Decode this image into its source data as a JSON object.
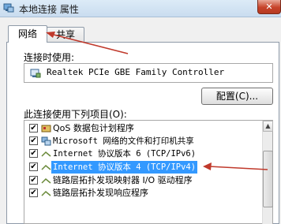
{
  "window": {
    "title": "本地连接 属性",
    "close_label": "✕"
  },
  "tabs": [
    {
      "label": "网络",
      "active": true
    },
    {
      "label": "共享",
      "active": false
    }
  ],
  "connect_using": {
    "label": "连接时使用:",
    "adapter": "Realtek PCIe GBE Family Controller",
    "configure_label": "配置(C)..."
  },
  "items_section": {
    "label": "此连接使用下列项目(O):",
    "items": [
      {
        "label": "QoS 数据包计划程序",
        "checked": true,
        "icon": "qos-icon"
      },
      {
        "label": "Microsoft 网络的文件和打印机共享",
        "checked": true,
        "icon": "network-share-icon"
      },
      {
        "label": "Internet 协议版本 6 (TCP/IPv6)",
        "checked": true,
        "icon": "protocol-icon"
      },
      {
        "label": "Internet 协议版本 4 (TCP/IPv4)",
        "checked": true,
        "icon": "protocol-icon",
        "selected": true
      },
      {
        "label": "链路层拓扑发现映射器 I/O 驱动程序",
        "checked": true,
        "icon": "protocol-icon"
      },
      {
        "label": "链路层拓扑发现响应程序",
        "checked": true,
        "icon": "protocol-icon"
      }
    ]
  },
  "colors": {
    "selection": "#3399ff",
    "annotation_arrow": "#c0392b"
  }
}
